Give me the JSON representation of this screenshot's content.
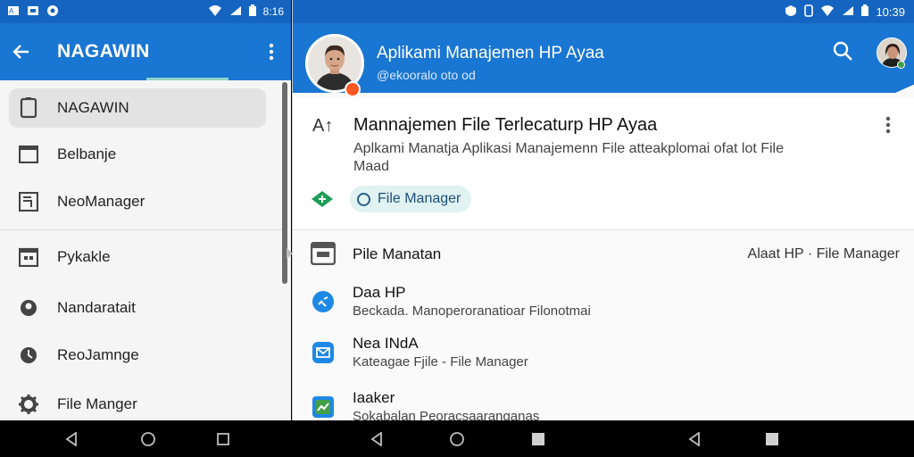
{
  "left": {
    "status": {
      "time": "8:16"
    },
    "appbar": {
      "title": "NAGAWIN"
    },
    "nav_items": [
      {
        "label": "NAGAWIN",
        "icon": "tablet-icon",
        "active": true
      },
      {
        "label": "Belbanje",
        "icon": "window-icon"
      },
      {
        "label": "NeoManager",
        "icon": "document-icon"
      },
      {
        "label": "Pykakle",
        "icon": "calendar-icon"
      },
      {
        "label": "Nandaratait",
        "icon": "location-pin-icon"
      },
      {
        "label": "ReoJamnge",
        "icon": "clock-icon"
      },
      {
        "label": "File Manger",
        "icon": "gear-icon"
      }
    ]
  },
  "right": {
    "status": {
      "time": "10:39"
    },
    "header": {
      "title": "Aplikami Manajemen HP Ayaa",
      "subtitle": "@ekooralo oto od"
    },
    "card": {
      "icon_text": "A↑",
      "title": "Mannajemen File Terlecaturp HP Ayaa",
      "description": "Aplkami Manatja Aplikasi Manajemenn File atteakplomai ofat lot File Maad",
      "chip_label": "File Manager"
    },
    "list": [
      {
        "title": "Pile Manatan",
        "trailing": "Alaat HP · File Manager",
        "icon": "folder-icon"
      },
      {
        "title": "Daa HP",
        "subtitle": "Beckada. Manoperoranatioar Filonotmai",
        "icon": "share-icon"
      },
      {
        "title": "Nea INdA",
        "subtitle": "Kateagae Fjile - File Manager",
        "icon": "mail-icon"
      },
      {
        "title": "Iaaker",
        "subtitle": "Sokabalan Peoracsaaranganas",
        "icon": "photo-icon"
      }
    ]
  },
  "colors": {
    "appbar": "#1976d2",
    "statusbar": "#1565c0",
    "accent": "#ff5722",
    "chip_bg": "#e0f2f1"
  }
}
